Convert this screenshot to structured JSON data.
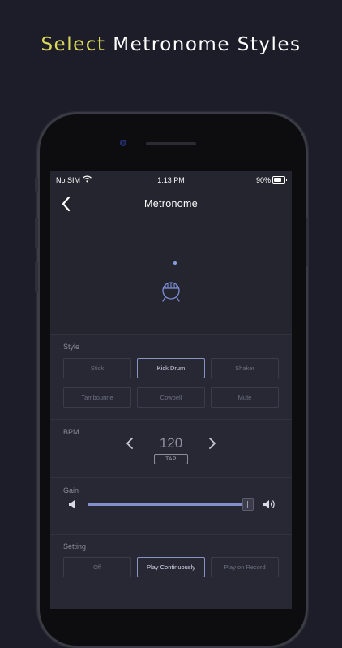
{
  "headline": {
    "highlight": "Select",
    "rest": "Metronome Styles"
  },
  "status": {
    "carrier": "No SIM",
    "time": "1:13 PM",
    "battery": "90%"
  },
  "nav": {
    "title": "Metronome",
    "back_icon": "chevron-left-icon"
  },
  "drum": {
    "icon": "kick-drum-icon"
  },
  "style": {
    "label": "Style",
    "options": [
      "Stick",
      "Kick Drum",
      "Shaker",
      "Tambourine",
      "Cowbell",
      "Mute"
    ],
    "selected": "Kick Drum"
  },
  "bpm": {
    "label": "BPM",
    "value": "120",
    "tap_label": "TAP"
  },
  "gain": {
    "label": "Gain",
    "level": 0.97
  },
  "setting": {
    "label": "Setting",
    "options": [
      "Off",
      "Play Continuously",
      "Play on Record"
    ],
    "selected": "Play Continuously"
  },
  "colors": {
    "accent": "#d9d65a",
    "slider": "#8390cc",
    "selected_border": "#8893c4",
    "background": "#1c1d29"
  }
}
